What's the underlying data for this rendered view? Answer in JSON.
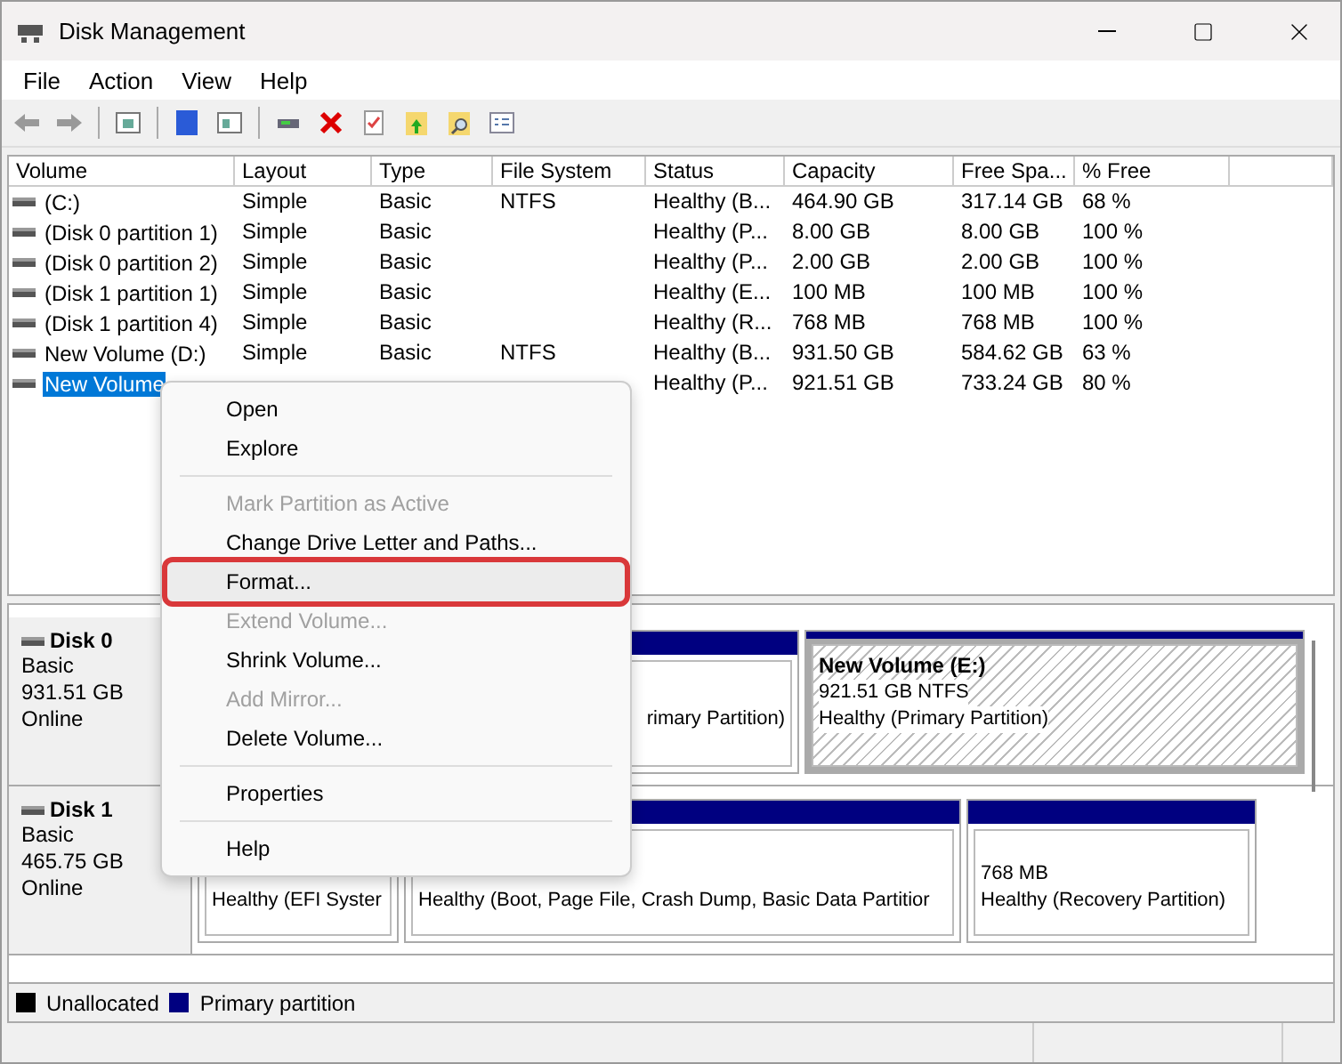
{
  "window": {
    "title": "Disk Management"
  },
  "menu_bar": [
    "File",
    "Action",
    "View",
    "Help"
  ],
  "table": {
    "columns": [
      "Volume",
      "Layout",
      "Type",
      "File System",
      "Status",
      "Capacity",
      "Free Spa...",
      "% Free"
    ],
    "rows": [
      {
        "selected": false,
        "cells": [
          "(C:)",
          "Simple",
          "Basic",
          "NTFS",
          "Healthy (B...",
          "464.90 GB",
          "317.14 GB",
          "68 %"
        ]
      },
      {
        "selected": false,
        "cells": [
          "(Disk 0 partition 1)",
          "Simple",
          "Basic",
          "",
          "Healthy (P...",
          "8.00 GB",
          "8.00 GB",
          "100 %"
        ]
      },
      {
        "selected": false,
        "cells": [
          "(Disk 0 partition 2)",
          "Simple",
          "Basic",
          "",
          "Healthy (P...",
          "2.00 GB",
          "2.00 GB",
          "100 %"
        ]
      },
      {
        "selected": false,
        "cells": [
          "(Disk 1 partition 1)",
          "Simple",
          "Basic",
          "",
          "Healthy (E...",
          "100 MB",
          "100 MB",
          "100 %"
        ]
      },
      {
        "selected": false,
        "cells": [
          "(Disk 1 partition 4)",
          "Simple",
          "Basic",
          "",
          "Healthy (R...",
          "768 MB",
          "768 MB",
          "100 %"
        ]
      },
      {
        "selected": false,
        "cells": [
          "New Volume (D:)",
          "Simple",
          "Basic",
          "NTFS",
          "Healthy (B...",
          "931.50 GB",
          "584.62 GB",
          "63 %"
        ]
      },
      {
        "selected": true,
        "cells": [
          "New Volume",
          "",
          "",
          "",
          "Healthy (P...",
          "921.51 GB",
          "733.24 GB",
          "80 %"
        ]
      }
    ]
  },
  "context_menu": [
    {
      "kind": "item",
      "label": "Open",
      "disabled": false,
      "highlighted": false
    },
    {
      "kind": "item",
      "label": "Explore",
      "disabled": false,
      "highlighted": false
    },
    {
      "kind": "separator"
    },
    {
      "kind": "item",
      "label": "Mark Partition as Active",
      "disabled": true,
      "highlighted": false
    },
    {
      "kind": "item",
      "label": "Change Drive Letter and Paths...",
      "disabled": false,
      "highlighted": false
    },
    {
      "kind": "item",
      "label": "Format...",
      "disabled": false,
      "highlighted": true
    },
    {
      "kind": "item",
      "label": "Extend Volume...",
      "disabled": true,
      "highlighted": false
    },
    {
      "kind": "item",
      "label": "Shrink Volume...",
      "disabled": false,
      "highlighted": false
    },
    {
      "kind": "item",
      "label": "Add Mirror...",
      "disabled": true,
      "highlighted": false
    },
    {
      "kind": "item",
      "label": "Delete Volume...",
      "disabled": false,
      "highlighted": false
    },
    {
      "kind": "separator"
    },
    {
      "kind": "item",
      "label": "Properties",
      "disabled": false,
      "highlighted": false
    },
    {
      "kind": "separator"
    },
    {
      "kind": "item",
      "label": "Help",
      "disabled": false,
      "highlighted": false
    }
  ],
  "disks": [
    {
      "name": "Disk 0",
      "type": "Basic",
      "size": "931.51 GB",
      "status": "Online",
      "partitions": [
        {
          "selected": false,
          "lines": [
            "rimary Partition)"
          ]
        },
        {
          "selected": true,
          "title": "New Volume  (E:)",
          "lines": [
            "921.51 GB NTFS",
            "Healthy (Primary Partition)"
          ]
        }
      ]
    },
    {
      "name": "Disk 1",
      "type": "Basic",
      "size": "465.75 GB",
      "status": "Online",
      "partitions": [
        {
          "selected": false,
          "lines": [
            "Healthy (EFI Syster"
          ]
        },
        {
          "selected": false,
          "lines": [
            "Healthy (Boot, Page File, Crash Dump, Basic Data Partitior"
          ]
        },
        {
          "selected": false,
          "lines": [
            "768 MB",
            "Healthy (Recovery Partition)"
          ]
        }
      ]
    }
  ],
  "legend": [
    {
      "label": "Unallocated",
      "color": "#000000"
    },
    {
      "label": "Primary partition",
      "color": "#000080"
    }
  ]
}
